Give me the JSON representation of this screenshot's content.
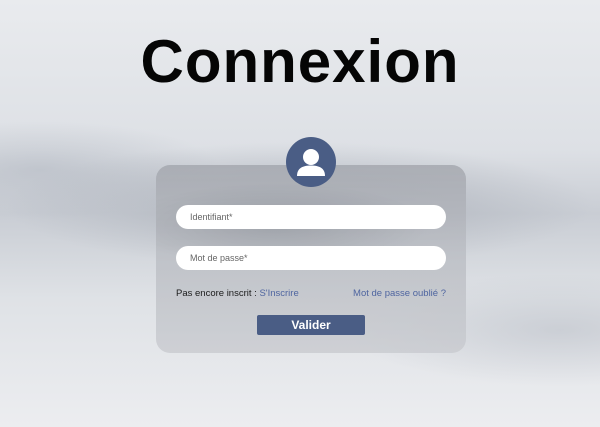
{
  "page": {
    "title": "Connexion"
  },
  "form": {
    "avatar_icon": "user-icon",
    "username": {
      "value": "",
      "placeholder": "Identifiant*"
    },
    "password": {
      "value": "",
      "placeholder": "Mot de passe*"
    },
    "signup_prompt": "Pas encore inscrit :",
    "signup_link": "S'Inscrire",
    "forgot_link": "Mot de passe oublié ?",
    "submit_label": "Valider"
  },
  "colors": {
    "accent": "#4a5d85",
    "link": "#4f65a0",
    "title": "#050505",
    "field_background": "#ffffff"
  }
}
